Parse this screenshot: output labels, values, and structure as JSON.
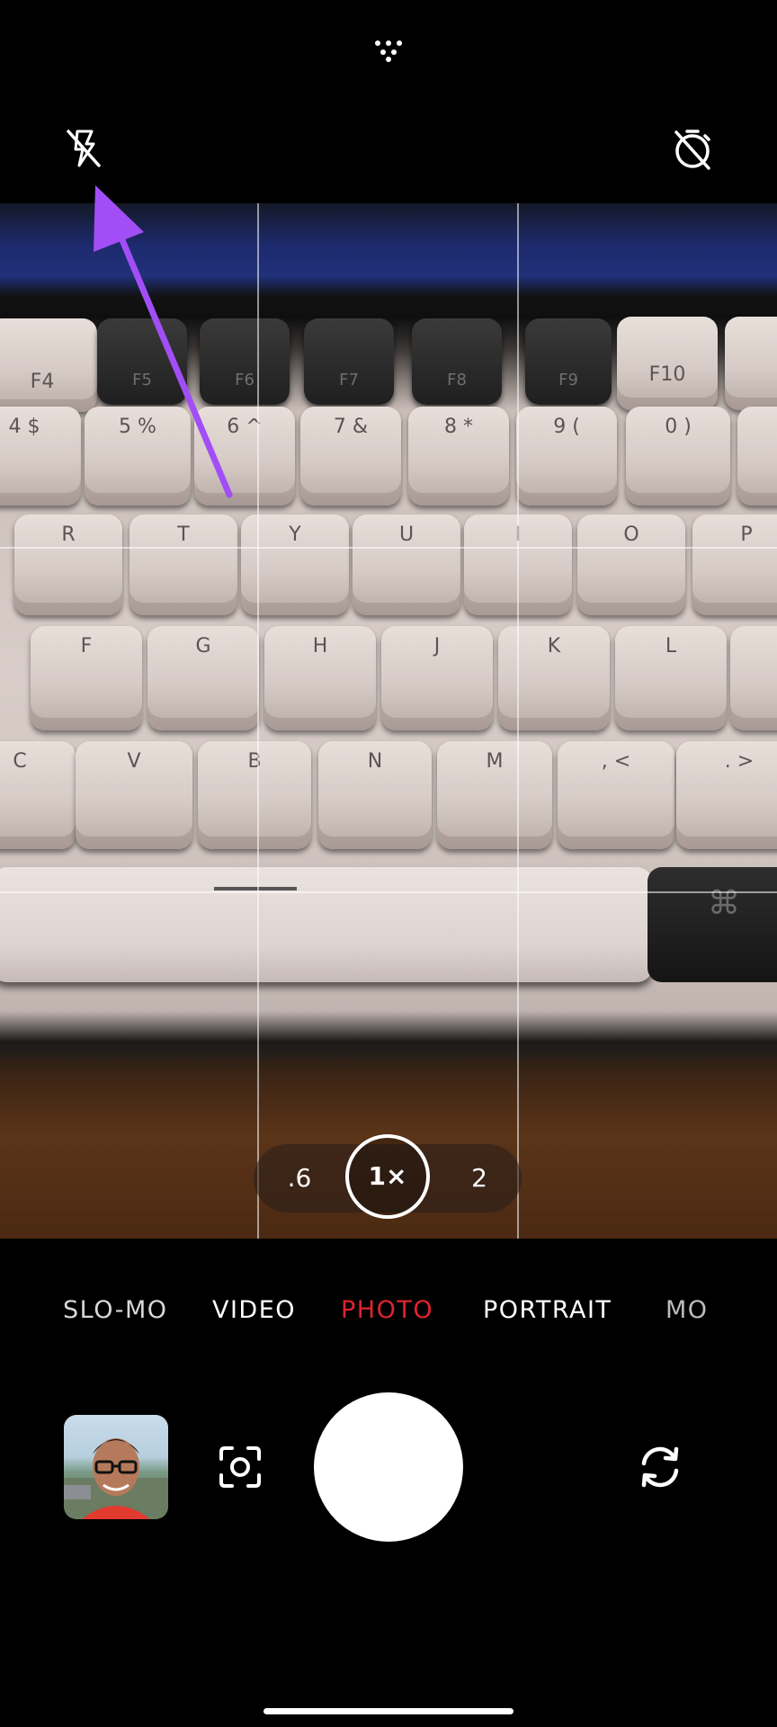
{
  "top_bar": {
    "more_icon": "more-dots-icon",
    "flash_icon": "flash-off-icon",
    "timer_icon": "timer-off-icon"
  },
  "viewfinder": {
    "keyboard_keys": {
      "row_f": [
        "F4",
        "F5",
        "F6",
        "F7",
        "F8",
        "F9",
        "F10"
      ],
      "row_num": [
        "4 $",
        "5 %",
        "6 ^",
        "7 &",
        "8 *",
        "9 (",
        "0 )"
      ],
      "row_top": [
        "R",
        "T",
        "Y",
        "U",
        "I",
        "O",
        "P"
      ],
      "row_home": [
        "F",
        "G",
        "H",
        "J",
        "K",
        "L"
      ],
      "row_bottom": [
        "C",
        "V",
        "B",
        "N",
        "M",
        ", <",
        ". >"
      ],
      "cmd": "⌘"
    },
    "annotation_color": "#a24ef6"
  },
  "zoom": {
    "options": [
      ".6",
      "1×",
      "2"
    ],
    "selected": "1×"
  },
  "modes": {
    "items": [
      "SLO-MO",
      "VIDEO",
      "PHOTO",
      "PORTRAIT",
      "MO"
    ],
    "selected": "PHOTO",
    "selected_color": "#e0232f"
  },
  "controls": {
    "gallery_icon": "gallery-thumbnail",
    "scan_icon": "lens-scan-icon",
    "shutter_icon": "shutter-button",
    "flip_icon": "flip-camera-icon"
  }
}
